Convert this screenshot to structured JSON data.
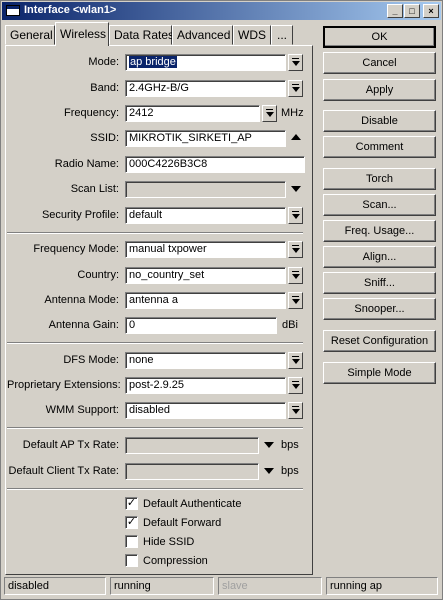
{
  "window": {
    "title": "Interface <wlan1>",
    "minimize": "_",
    "maximize": "□",
    "close": "×"
  },
  "tabs": [
    "General",
    "Wireless",
    "Data Rates",
    "Advanced",
    "WDS",
    "..."
  ],
  "active_tab": "Wireless",
  "form": {
    "mode": {
      "label": "Mode:",
      "value": "ap bridge"
    },
    "band": {
      "label": "Band:",
      "value": "2.4GHz-B/G"
    },
    "frequency": {
      "label": "Frequency:",
      "value": "2412",
      "unit": "MHz"
    },
    "ssid": {
      "label": "SSID:",
      "value": "MIKROTIK_SIRKETI_AP"
    },
    "radio_name": {
      "label": "Radio Name:",
      "value": "000C4226B3C8"
    },
    "scan_list": {
      "label": "Scan List:",
      "value": ""
    },
    "security_profile": {
      "label": "Security Profile:",
      "value": "default"
    },
    "frequency_mode": {
      "label": "Frequency Mode:",
      "value": "manual txpower"
    },
    "country": {
      "label": "Country:",
      "value": "no_country_set"
    },
    "antenna_mode": {
      "label": "Antenna Mode:",
      "value": "antenna a"
    },
    "antenna_gain": {
      "label": "Antenna Gain:",
      "value": "0",
      "unit": "dBi"
    },
    "dfs_mode": {
      "label": "DFS Mode:",
      "value": "none"
    },
    "proprietary_extensions": {
      "label": "Proprietary Extensions:",
      "value": "post-2.9.25"
    },
    "wmm_support": {
      "label": "WMM Support:",
      "value": "disabled"
    },
    "default_ap_tx_rate": {
      "label": "Default AP Tx Rate:",
      "value": "",
      "unit": "bps"
    },
    "default_client_tx_rate": {
      "label": "Default Client Tx Rate:",
      "value": "",
      "unit": "bps"
    },
    "checkboxes": [
      {
        "label": "Default Authenticate",
        "checked": true,
        "mark": "✓"
      },
      {
        "label": "Default Forward",
        "checked": true,
        "mark": "✓"
      },
      {
        "label": "Hide SSID",
        "checked": false,
        "mark": ""
      },
      {
        "label": "Compression",
        "checked": false,
        "mark": ""
      }
    ]
  },
  "buttons": [
    "OK",
    "Cancel",
    "Apply",
    "Disable",
    "Comment",
    "Torch",
    "Scan...",
    "Freq. Usage...",
    "Align...",
    "Sniff...",
    "Snooper...",
    "Reset Configuration",
    "Simple Mode"
  ],
  "status_bar": [
    "disabled",
    "running",
    "slave",
    "running ap"
  ]
}
